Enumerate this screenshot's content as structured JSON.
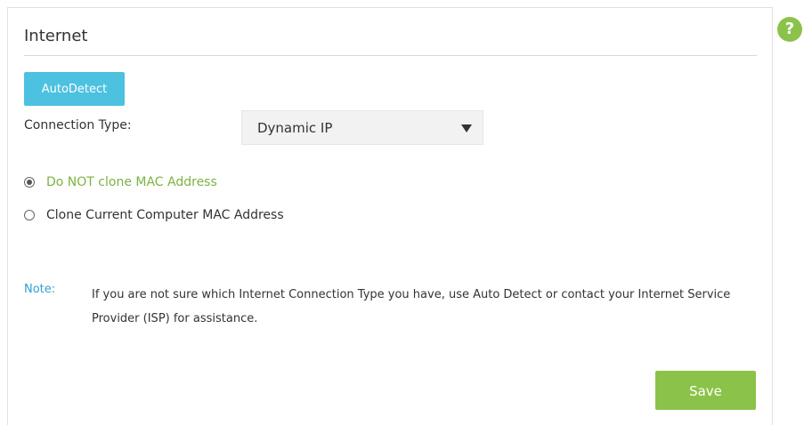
{
  "section": {
    "title": "Internet"
  },
  "help": {
    "glyph": "?"
  },
  "autodetect": {
    "label": "AutoDetect"
  },
  "connection": {
    "label": "Connection Type:",
    "selected": "Dynamic IP"
  },
  "mac_options": [
    {
      "label": "Do NOT clone MAC Address",
      "checked": true
    },
    {
      "label": "Clone Current Computer MAC Address",
      "checked": false
    }
  ],
  "note": {
    "label": "Note:",
    "text": "If you are not sure which Internet Connection Type you have, use Auto Detect or contact your Internet Service Provider (ISP) for assistance."
  },
  "actions": {
    "save_label": "Save"
  },
  "colors": {
    "accent_green": "#8bc34a",
    "accent_blue": "#4cc1e0",
    "note_blue": "#2f9fd8"
  }
}
